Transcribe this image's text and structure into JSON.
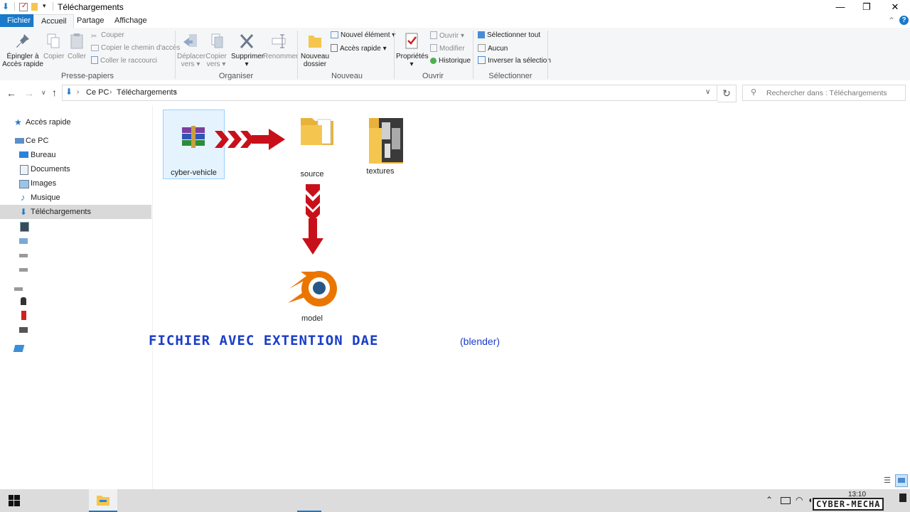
{
  "window": {
    "title": "Téléchargements",
    "min_glyph": "—",
    "restore_glyph": "❐",
    "close_glyph": "✕"
  },
  "tabs": {
    "fichier": "Fichier",
    "accueil": "Accueil",
    "partage": "Partage",
    "affichage": "Affichage"
  },
  "ribbon": {
    "presse_papiers": {
      "label": "Presse-papiers",
      "epingler": "Épingler à Accès rapide",
      "copier": "Copier",
      "coller": "Coller",
      "couper": "Couper",
      "copier_chemin": "Copier le chemin d'accès",
      "coller_raccourci": "Coller le raccourci"
    },
    "organiser": {
      "label": "Organiser",
      "deplacer": "Déplacer vers",
      "copier_vers": "Copier vers",
      "supprimer": "Supprimer",
      "renommer": "Renommer"
    },
    "nouveau": {
      "label": "Nouveau",
      "nouveau_dossier": "Nouveau dossier",
      "nouvel_element": "Nouvel élément",
      "acces_rapide": "Accès rapide"
    },
    "ouvrir": {
      "label": "Ouvrir",
      "proprietes": "Propriétés",
      "ouvrir": "Ouvrir",
      "modifier": "Modifier",
      "historique": "Historique"
    },
    "selectionner": {
      "label": "Sélectionner",
      "tout": "Sélectionner tout",
      "aucun": "Aucun",
      "inverser": "Inverser la sélection"
    }
  },
  "address": {
    "crumbs": [
      "Ce PC",
      "Téléchargements"
    ],
    "search_placeholder": "Rechercher dans : Téléchargements"
  },
  "sidebar": {
    "items": [
      {
        "label": "Accès rapide",
        "icon": "star-icon"
      },
      {
        "label": "Ce PC",
        "icon": "pc-icon"
      },
      {
        "label": "Bureau",
        "icon": "desktop-icon"
      },
      {
        "label": "Documents",
        "icon": "documents-icon"
      },
      {
        "label": "Images",
        "icon": "images-icon"
      },
      {
        "label": "Musique",
        "icon": "music-icon"
      },
      {
        "label": "Téléchargements",
        "icon": "download-icon"
      }
    ]
  },
  "files": [
    {
      "name": "cyber-vehicle",
      "icon": "winrar-archive-icon"
    },
    {
      "name": "source",
      "icon": "folder-icon"
    },
    {
      "name": "textures",
      "icon": "folder-textures-icon"
    },
    {
      "name": "model",
      "icon": "blender-icon"
    }
  ],
  "caption": {
    "main": "FICHIER AVEC EXTENTION DAE",
    "sub": "(blender)"
  },
  "taskbar": {
    "time": "13:10",
    "watermark": "CYBER-MECHA"
  },
  "colors": {
    "accent": "#1979ca",
    "arrow": "#c8101a",
    "caption": "#1a3dc8",
    "folder": "#f5c64f",
    "blender_orange": "#ea7600",
    "blender_blue": "#265787"
  }
}
